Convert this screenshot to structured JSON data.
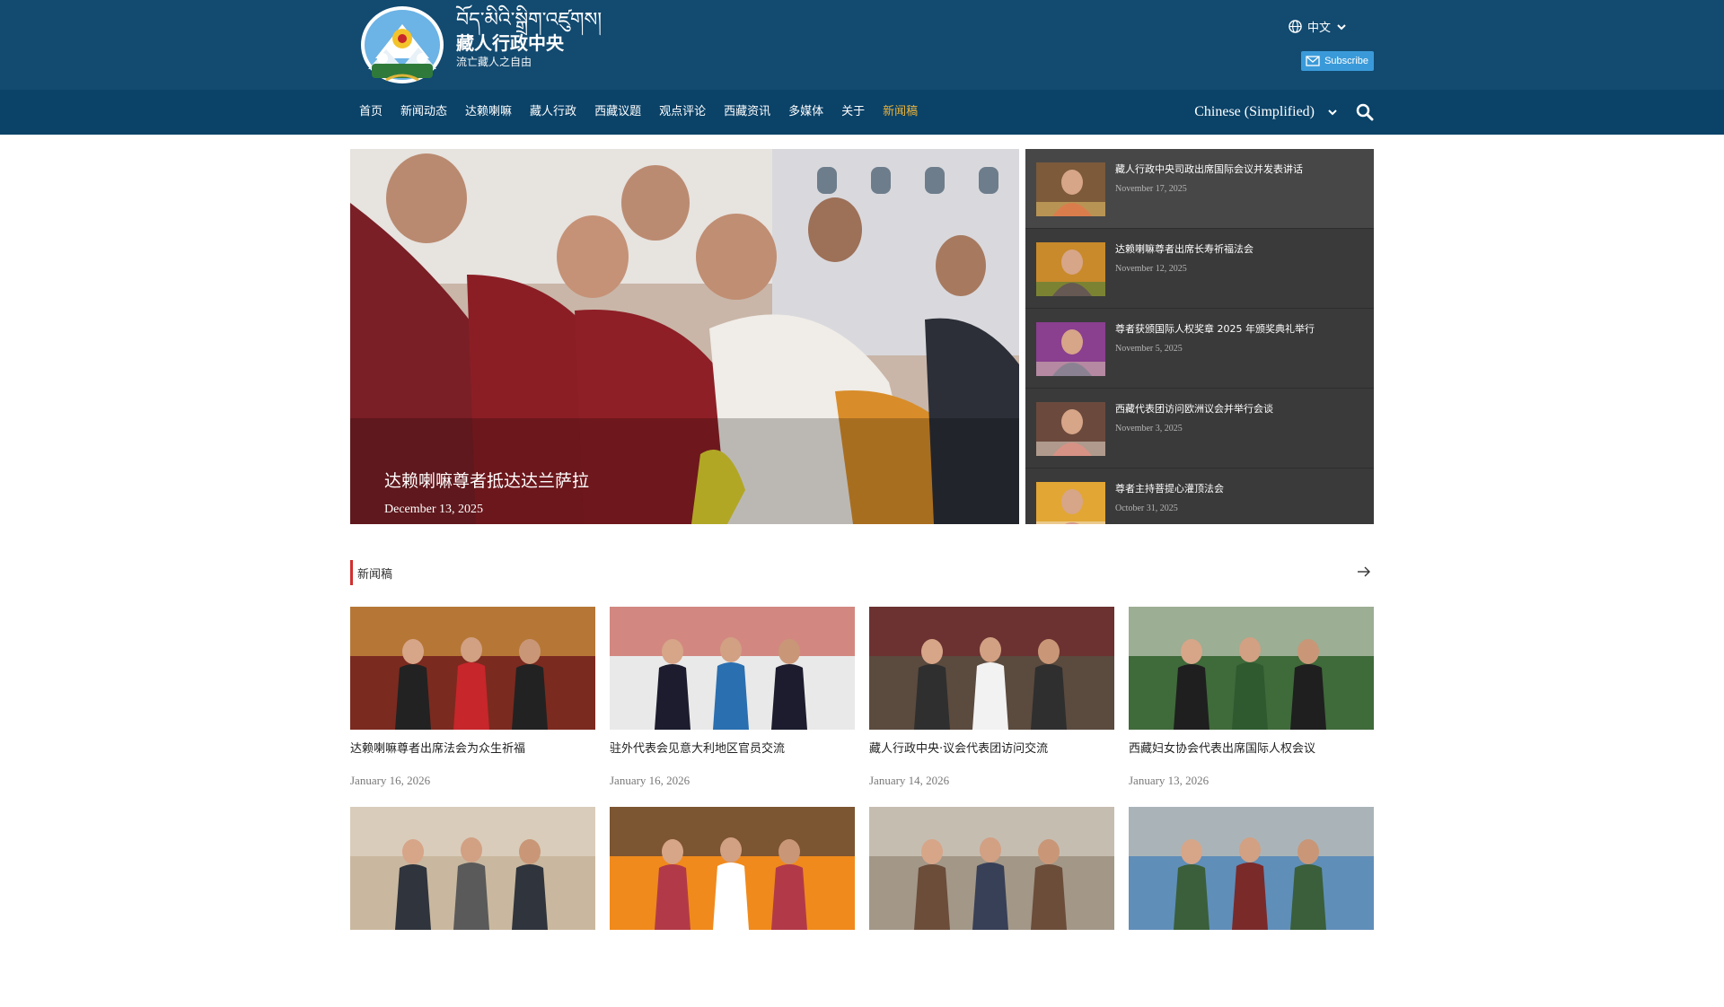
{
  "header": {
    "brand_tibetan": "བོད་མིའི་སྒྲིག་འཛུགས།",
    "brand_chinese": "藏人行政中央",
    "brand_sub": "流亡藏人之自由",
    "lang_label": "中文",
    "subscribe_label": "Subscribe"
  },
  "nav": {
    "items": [
      "首页",
      "新闻动态",
      "达赖喇嘛",
      "藏人行政",
      "西藏议题",
      "观点评论",
      "西藏资讯",
      "多媒体",
      "关于",
      "新闻稿"
    ],
    "active_index": 9,
    "language_value": "Chinese (Simplified)"
  },
  "hero": {
    "title": "达赖喇嘛尊者抵达达兰萨拉",
    "date": "December 13, 2025"
  },
  "side_list": [
    {
      "title": "藏人行政中央司政出席国际会议并发表讲话",
      "date": "November 17, 2025"
    },
    {
      "title": "达赖喇嘛尊者出席长寿祈福法会",
      "date": "November 12, 2025"
    },
    {
      "title": "尊者获颁国际人权奖章 2025 年颁奖典礼举行",
      "date": "November 5, 2025"
    },
    {
      "title": "西藏代表团访问欧洲议会并举行会谈",
      "date": "November 3, 2025"
    },
    {
      "title": "尊者主持菩提心灌顶法会",
      "date": "October 31, 2025"
    }
  ],
  "section": {
    "title": "新闻稿"
  },
  "cards": [
    {
      "title": "达赖喇嘛尊者出席法会为众生祈福",
      "date": "January 16, 2026"
    },
    {
      "title": "驻外代表会见意大利地区官员交流",
      "date": "January 16, 2026"
    },
    {
      "title": "藏人行政中央·议会代表团访问交流",
      "date": "January 14, 2026"
    },
    {
      "title": "西藏妇女协会代表出席国际人权会议",
      "date": "January 13, 2026"
    },
    {
      "title": "",
      "date": ""
    },
    {
      "title": "",
      "date": ""
    },
    {
      "title": "",
      "date": ""
    },
    {
      "title": "",
      "date": ""
    }
  ],
  "colors": {
    "top_band": "#124a70",
    "nav_bar": "#0a4268",
    "accent_active": "#e9b23b",
    "section_bar": "#d12f2f",
    "subscribe_btn": "#3a9ad9",
    "side_bg": "#3a3a3a"
  }
}
